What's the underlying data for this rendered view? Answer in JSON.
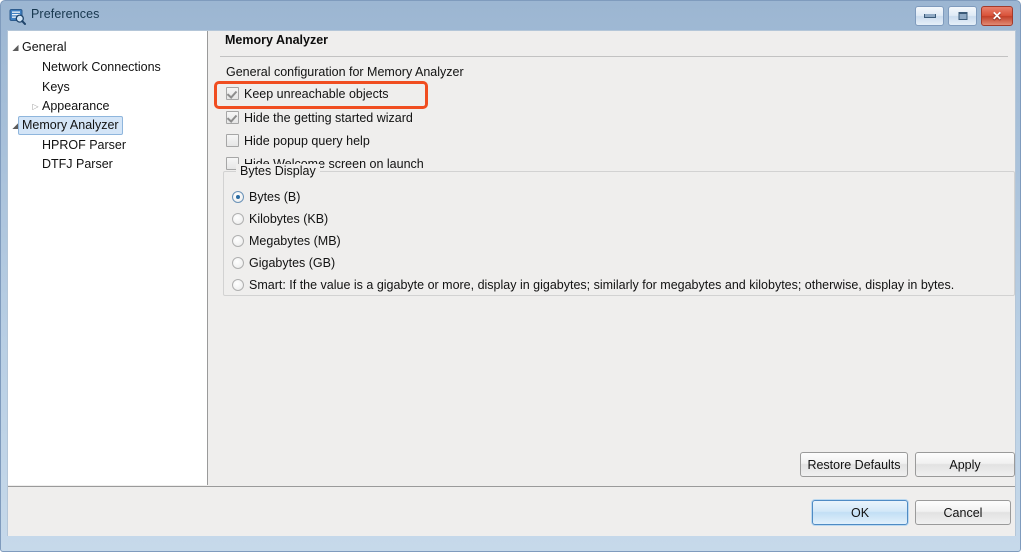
{
  "window": {
    "title": "Preferences",
    "icon": "preferences-search-icon",
    "controls": {
      "minimize": "–",
      "maximize": "□",
      "close": "✕"
    }
  },
  "sidebar": {
    "items": [
      {
        "label": "General",
        "arrow": "expanded",
        "indent": 0,
        "selected": false
      },
      {
        "label": "Network Connections",
        "arrow": "none",
        "indent": 1,
        "selected": false
      },
      {
        "label": "Keys",
        "arrow": "none",
        "indent": 1,
        "selected": false
      },
      {
        "label": "Appearance",
        "arrow": "collapsed",
        "indent": 1,
        "selected": false
      },
      {
        "label": "Memory Analyzer",
        "arrow": "expanded",
        "indent": 0,
        "selected": true
      },
      {
        "label": "HPROF Parser",
        "arrow": "none",
        "indent": 1,
        "selected": false
      },
      {
        "label": "DTFJ Parser",
        "arrow": "none",
        "indent": 1,
        "selected": false
      }
    ]
  },
  "main": {
    "title": "Memory Analyzer",
    "description": "General configuration for Memory Analyzer",
    "checkboxes": [
      {
        "label": "Keep unreachable objects",
        "checked": true
      },
      {
        "label": "Hide the getting started wizard",
        "checked": true
      },
      {
        "label": "Hide popup query help",
        "checked": false
      },
      {
        "label": "Hide Welcome screen on launch",
        "checked": false
      }
    ],
    "bytes_display": {
      "title": "Bytes Display",
      "options": [
        {
          "label": "Bytes (B)",
          "selected": true
        },
        {
          "label": "Kilobytes (KB)",
          "selected": false
        },
        {
          "label": "Megabytes (MB)",
          "selected": false
        },
        {
          "label": "Gigabytes (GB)",
          "selected": false
        },
        {
          "label": "Smart: If the value is a gigabyte or more, display in gigabytes; similarly for megabytes and kilobytes; otherwise, display in bytes.",
          "selected": false
        }
      ]
    },
    "buttons": {
      "restore_defaults": "Restore Defaults",
      "apply": "Apply"
    }
  },
  "footer": {
    "ok": "OK",
    "cancel": "Cancel"
  },
  "annotation": {
    "color": "#f04d20",
    "target": "Keep unreachable objects"
  }
}
